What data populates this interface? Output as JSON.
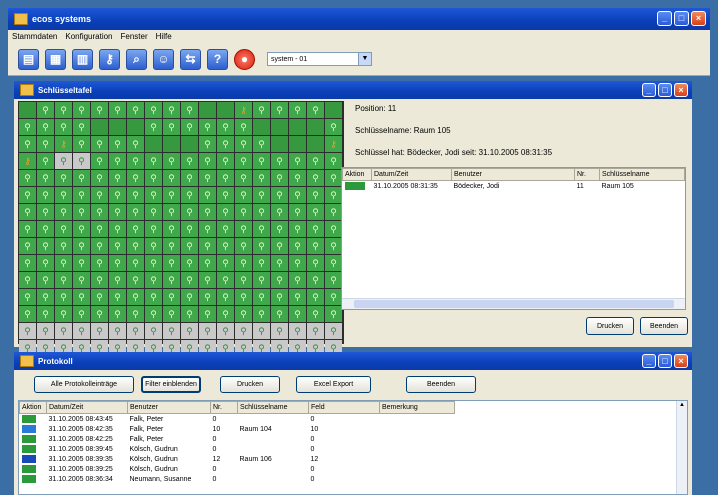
{
  "app": {
    "title": "ecos systems"
  },
  "menu": [
    {
      "label": "Stammdaten",
      "key": "S"
    },
    {
      "label": "Konfiguration",
      "key": "K"
    },
    {
      "label": "Fenster",
      "key": "F"
    },
    {
      "label": "Hilfe",
      "key": "H"
    }
  ],
  "toolbar": {
    "icons": [
      "book-icon",
      "grid-icon",
      "map-icon",
      "key-icon",
      "search-icon",
      "person-icon",
      "transfer-icon",
      "help-icon",
      "stop-icon"
    ],
    "system_select": "system - 01"
  },
  "keyboard": {
    "title": "Schlüsseltafel",
    "position_label": "Position: 11",
    "key_name_label": "Schlüsselname: Raum 105",
    "holder_label": "Schlüssel hat: Bödecker, Jodi seit: 31.10.2005 08:31:35",
    "table_headers": [
      "Aktion",
      "Datum/Zeit",
      "Benutzer",
      "Nr.",
      "Schlüsselname"
    ],
    "rows": [
      {
        "aktion_color": "#2a9a3a",
        "datum": "31.10.2005 08:31:35",
        "benutzer": "Bödecker, Jodi",
        "nr": "11",
        "name": "Raum 105"
      }
    ],
    "buttons": {
      "print": "Drucken",
      "close": "Beenden"
    }
  },
  "protocol": {
    "title": "Protokoll",
    "buttons": {
      "all": "Alle Protokolleinträge",
      "filter": "Filter einblenden",
      "print": "Drucken",
      "excel": "Excel Export",
      "close": "Beenden"
    },
    "table_headers": [
      "Aktion",
      "Datum/Zeit",
      "Benutzer",
      "Nr.",
      "Schlüsselname",
      "Feld",
      "Bemerkung"
    ],
    "rows": [
      {
        "icon": "door-in",
        "datum": "31.10.2005 08:43:45",
        "benutzer": "Falk, Peter",
        "nr": "0",
        "name": "",
        "feld": "0"
      },
      {
        "icon": "key-out",
        "datum": "31.10.2005 08:42:35",
        "benutzer": "Falk, Peter",
        "nr": "10",
        "name": "Raum 104",
        "feld": "10"
      },
      {
        "icon": "door-in",
        "datum": "31.10.2005 08:42:25",
        "benutzer": "Falk, Peter",
        "nr": "0",
        "name": "",
        "feld": "0"
      },
      {
        "icon": "door-in",
        "datum": "31.10.2005 08:39:45",
        "benutzer": "Kölsch, Gudrun",
        "nr": "0",
        "name": "",
        "feld": "0"
      },
      {
        "icon": "key-in",
        "datum": "31.10.2005 08:39:35",
        "benutzer": "Kölsch, Gudrun",
        "nr": "12",
        "name": "Raum 106",
        "feld": "12"
      },
      {
        "icon": "door-in",
        "datum": "31.10.2005 08:39:25",
        "benutzer": "Kölsch, Gudrun",
        "nr": "0",
        "name": "",
        "feld": "0"
      },
      {
        "icon": "door-in",
        "datum": "31.10.2005 08:36:34",
        "benutzer": "Neumann, Susanne",
        "nr": "0",
        "name": "",
        "feld": "0"
      }
    ]
  },
  "colors": {
    "accent": "#0a3fb8",
    "cell_green": "#3fa84a",
    "cell_grey": "#c9c9c9",
    "key_orange": "#f59a2a"
  }
}
